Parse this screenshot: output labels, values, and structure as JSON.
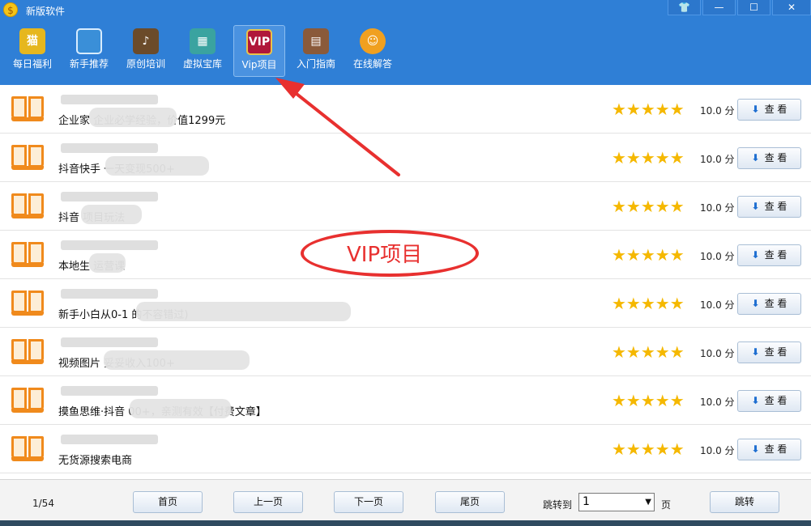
{
  "window": {
    "title": "新版软件",
    "buttons": [
      "skin-icon",
      "minimize-icon",
      "maximize-icon",
      "close-icon"
    ]
  },
  "toolbar": {
    "items": [
      {
        "label": "每日福利",
        "icon": "lucky-cat-icon",
        "color": "#e6b71e"
      },
      {
        "label": "新手推荐",
        "icon": "monitor-icon",
        "color": "#3a8fd8"
      },
      {
        "label": "原创培训",
        "icon": "blackboard-icon",
        "color": "#6b4b2a"
      },
      {
        "label": "虚拟宝库",
        "icon": "storage-icon",
        "color": "#3aa3a0"
      },
      {
        "label": "Vip项目",
        "icon": "vip-icon",
        "color": "#b0173a",
        "active": true
      },
      {
        "label": "入门指南",
        "icon": "guide-book-icon",
        "color": "#8a5a3a"
      },
      {
        "label": "在线解答",
        "icon": "support-agent-icon",
        "color": "#f0a020"
      }
    ]
  },
  "list": {
    "rows": [
      {
        "title": "企业家                           企业必学经验，价值1299元",
        "rating": "★★★★★",
        "score": "10.0 分",
        "action": "查 看"
      },
      {
        "title": "抖音快手                                  一天变现500+",
        "rating": "★★★★★",
        "score": "10.0 分",
        "action": "查 看"
      },
      {
        "title": "抖音                    项目玩法",
        "rating": "★★★★★",
        "score": "10.0 分",
        "action": "查 看"
      },
      {
        "title": "本地生            运营课",
        "rating": "★★★★★",
        "score": "10.0 分",
        "action": "查 看"
      },
      {
        "title": "新手小白从0-1                                                                         的不容错过)",
        "rating": "★★★★★",
        "score": "10.0 分",
        "action": "查 看"
      },
      {
        "title": "视频图片                                               妥妥收入100+",
        "rating": "★★★★★",
        "score": "10.0 分",
        "action": "查 看"
      },
      {
        "title": "摸鱼思维·抖音                                  00+，亲测有效【付费文章】",
        "rating": "★★★★★",
        "score": "10.0 分",
        "action": "查 看"
      },
      {
        "title": "无货源搜索电商",
        "rating": "★★★★★",
        "score": "10.0 分",
        "action": "查 看"
      }
    ]
  },
  "footer": {
    "page_info": "1/54",
    "first": "首页",
    "prev": "上一页",
    "next": "下一页",
    "last": "尾页",
    "jump_label": "跳转到",
    "jump_value": "1",
    "page_unit": "页",
    "jump_button": "跳转"
  },
  "annotation": {
    "text": "VIP项目",
    "color": "#e8302f"
  }
}
